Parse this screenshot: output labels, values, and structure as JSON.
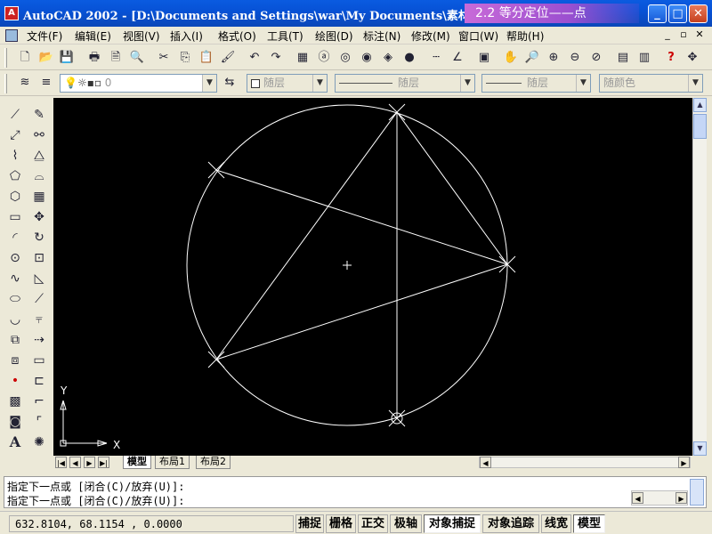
{
  "window": {
    "title": "AutoCAD 2002 - [D:\\Documents and Settings\\war\\My Documents\\素材",
    "overlay_tag": "2.2 等分定位——点",
    "minimize": "_",
    "maximize": "□",
    "close": "✕"
  },
  "menu": {
    "items": [
      "文件(F)",
      "编辑(E)",
      "视图(V)",
      "插入(I)",
      "格式(O)",
      "工具(T)",
      "绘图(D)",
      "标注(N)",
      "修改(M)",
      "窗口(W)",
      "帮助(H)"
    ],
    "mdi_minimize": "_",
    "mdi_restore": "▫",
    "mdi_close": "✕"
  },
  "layer_toolbar": {
    "layer_value": "0",
    "color_value": "随层",
    "linetype_value": "随层",
    "lineweight_value": "随层",
    "plotstyle_value": "随颜色"
  },
  "axis_labels": {
    "x": "X",
    "y": "Y"
  },
  "layout_tabs": [
    "模型",
    "布局1",
    "布局2"
  ],
  "command_lines": [
    "指定下一点或 [闭合(C)/放弃(U)]:",
    "指定下一点或 [闭合(C)/放弃(U)]:"
  ],
  "status": {
    "coordinates": "632.8104, 68.1154 , 0.0000",
    "buttons": [
      {
        "label": "捕捉",
        "on": false
      },
      {
        "label": "栅格",
        "on": false
      },
      {
        "label": "正交",
        "on": false
      },
      {
        "label": "极轴",
        "on": false
      },
      {
        "label": "对象捕捉",
        "on": true
      },
      {
        "label": "对象追踪",
        "on": false
      },
      {
        "label": "线宽",
        "on": false
      },
      {
        "label": "模型",
        "on": true
      }
    ]
  },
  "colors": {
    "canvas": "#000000",
    "geometry": "#ffffff",
    "titlebar": "#0a5be0",
    "overlay_tag": "#b85cd8"
  }
}
